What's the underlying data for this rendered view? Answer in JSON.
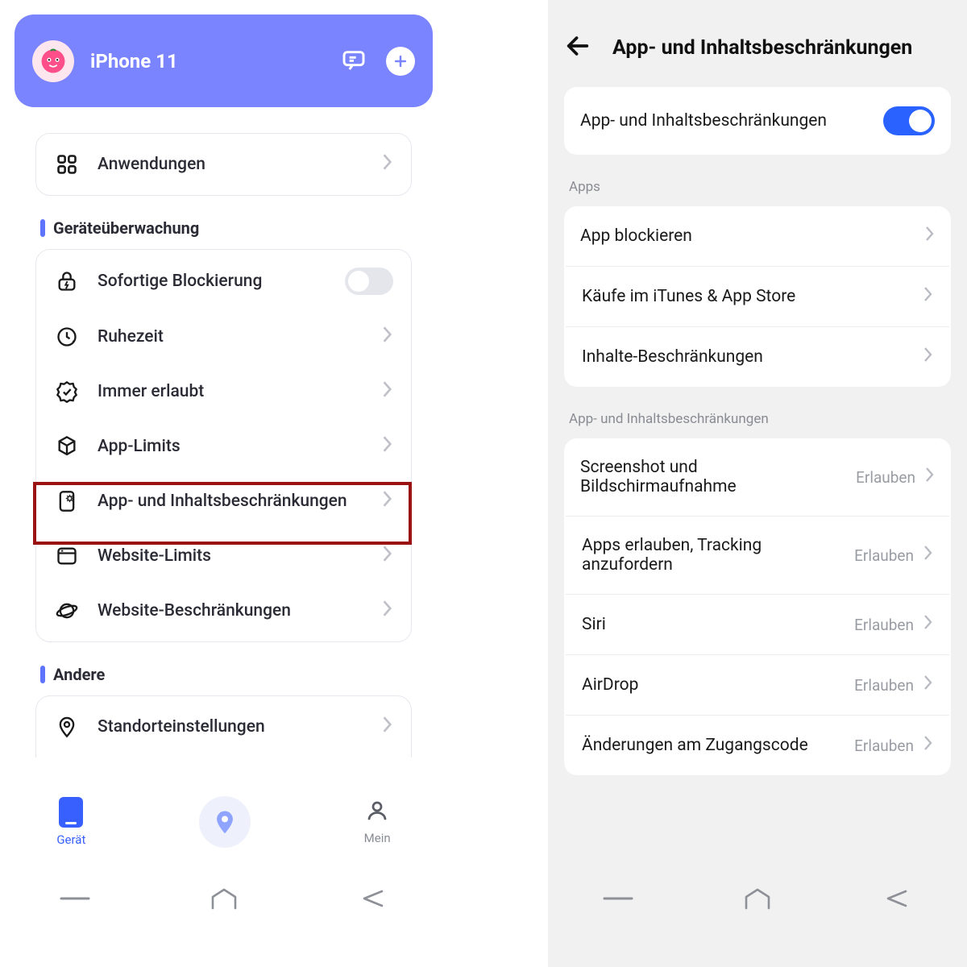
{
  "left": {
    "header": {
      "device_name": "iPhone 11"
    },
    "card_top": {
      "row_apps": "Anwendungen"
    },
    "section_monitoring": {
      "title": "Geräteüberwachung",
      "rows": {
        "instant_block": "Sofortige Blockierung",
        "downtime": "Ruhezeit",
        "always_allowed": "Immer erlaubt",
        "app_limits": "App-Limits",
        "content_restrictions": "App- und Inhaltsbeschränkungen",
        "website_limits": "Website-Limits",
        "website_restrictions": "Website-Beschränkungen"
      }
    },
    "section_other": {
      "title": "Andere",
      "rows": {
        "location_settings": "Standorteinstellungen"
      }
    },
    "bottom_nav": {
      "device": "Gerät",
      "mine": "Mein"
    }
  },
  "right": {
    "title": "App- und Inhaltsbeschränkungen",
    "main_toggle_label": "App- und Inhaltsbeschränkungen",
    "section_apps": {
      "title": "Apps",
      "rows": {
        "block_app": "App blockieren",
        "purchases": "Käufe im iTunes & App Store",
        "content": "Inhalte-Beschränkungen"
      }
    },
    "section_restrictions": {
      "title": "App- und Inhaltsbeschränkungen",
      "allow_value": "Erlauben",
      "rows": {
        "screenshot": "Screenshot und Bildschirmaufnahme",
        "tracking": "Apps erlauben, Tracking anzufordern",
        "siri": "Siri",
        "airdrop": "AirDrop",
        "passcode": "Änderungen am Zugangscode"
      }
    }
  }
}
